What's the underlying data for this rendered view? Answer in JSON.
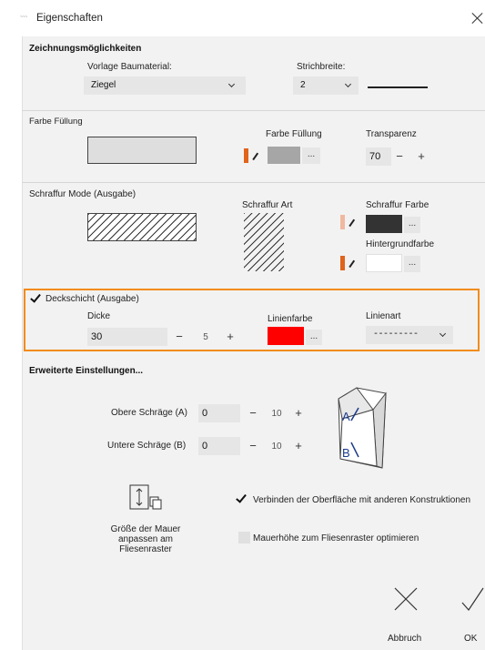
{
  "window": {
    "title": "Eigenschaften",
    "app_icon_text": "~~~"
  },
  "drawing": {
    "heading": "Zeichnungsmöglichkeiten",
    "template_label": "Vorlage Baumaterial:",
    "template_value": "Ziegel",
    "stroke_label": "Strichbreite:",
    "stroke_value": "2"
  },
  "fill": {
    "heading": "Farbe Füllung",
    "color_label": "Farbe Füllung",
    "color_button": "...",
    "transparency_label": "Transparenz",
    "transparency_value": "70",
    "minus": "−",
    "plus": "+",
    "swatch_color": "#a6a6a6",
    "bucket_color": "#e0641a"
  },
  "hatch": {
    "heading": "Schraffur Mode (Ausgabe)",
    "type_label": "Schraffur Art",
    "color_label": "Schraffur Farbe",
    "color_button": "...",
    "bg_label": "Hintergrundfarbe",
    "bg_button": "...",
    "hatch_color": "#333333",
    "bg_color": "#ffffff"
  },
  "cover": {
    "checkbox_label": "Deckschicht (Ausgabe)",
    "checked": true,
    "thickness_label": "Dicke",
    "thickness_value": "30",
    "minus": "−",
    "step_value": "5",
    "plus": "+",
    "line_color_label": "Linienfarbe",
    "line_color_button": "...",
    "line_color": "#ff0000",
    "line_type_label": "Linienart",
    "line_type_value": "---------",
    "frame_color": "#f28c1a"
  },
  "advanced": {
    "heading": "Erweiterte Einstellungen...",
    "upper_label": "Obere Schräge (A)",
    "upper_value": "0",
    "upper_minus": "−",
    "upper_step": "10",
    "upper_plus": "+",
    "lower_label": "Untere Schräge (B)",
    "lower_value": "0",
    "lower_minus": "−",
    "lower_step": "10",
    "lower_plus": "+",
    "diagram_a": "A",
    "diagram_b": "B",
    "fit_label": "Größe der Mauer anpassen am Fliesenraster",
    "connect_label": "Verbinden der Oberfläche mit anderen Konstruktionen",
    "connect_checked": true,
    "optimize_label": "Mauerhöhe zum Fliesenraster optimieren",
    "optimize_checked": false
  },
  "footer": {
    "cancel_label": "Abbruch",
    "ok_label": "OK"
  }
}
